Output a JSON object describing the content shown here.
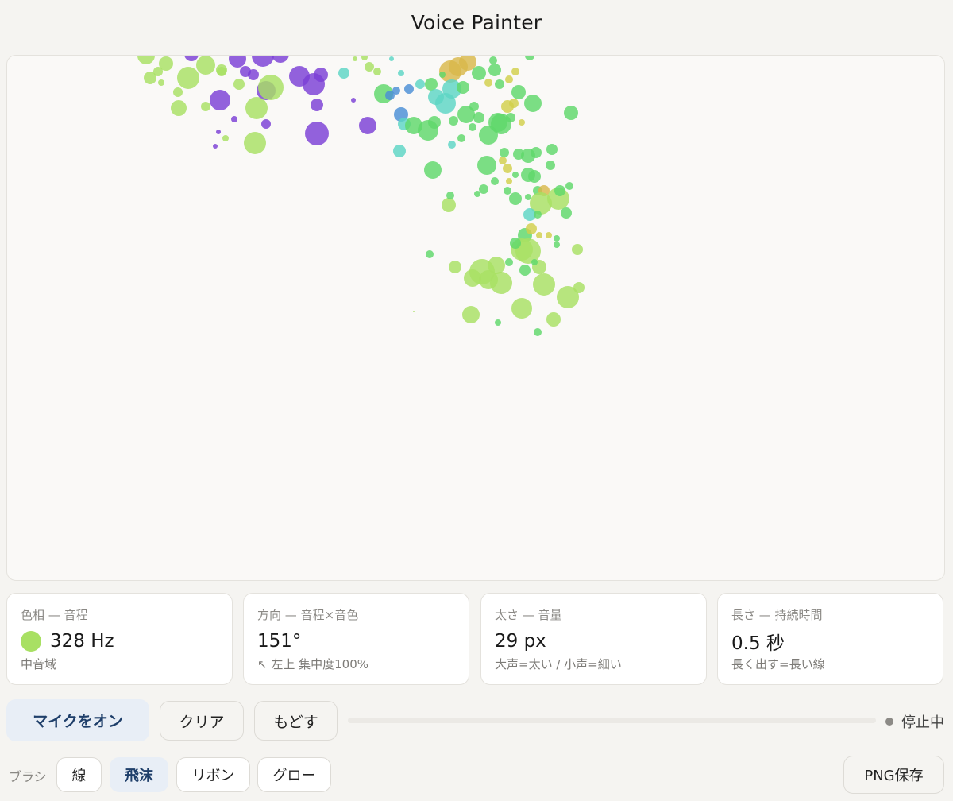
{
  "app": {
    "title": "Voice Painter"
  },
  "cards": [
    {
      "label": "色相 — 音程",
      "value": "328 Hz",
      "sub": "中音域",
      "swatch": "#a8e063"
    },
    {
      "label": "方向 — 音程×音色",
      "value": "151°",
      "sub": "↖ 左上 集中度100%"
    },
    {
      "label": "太さ — 音量",
      "value": "29 px",
      "sub": "大声=太い / 小声=細い"
    },
    {
      "label": "長さ — 持続時間",
      "value": "0.5 秒",
      "sub": "長く出す=長い線"
    }
  ],
  "controls": {
    "mic_label": "マイクをオン",
    "clear_label": "クリア",
    "undo_label": "もどす",
    "status_label": "停止中",
    "input_level": 0
  },
  "brush": {
    "label": "ブラシ",
    "options": [
      "線",
      "飛沫",
      "リボン",
      "グロー"
    ],
    "selected": "飛沫"
  },
  "export": {
    "png_label": "PNG保存"
  },
  "colors": {
    "purple": "#7b3fd6",
    "lime": "#a8e063",
    "green": "#5fd86a",
    "teal": "#5dd6c4",
    "blue": "#4a8fd6",
    "yellow": "#d2d04a",
    "gold": "#d9b84a",
    "accent": "#1f3f6a"
  }
}
